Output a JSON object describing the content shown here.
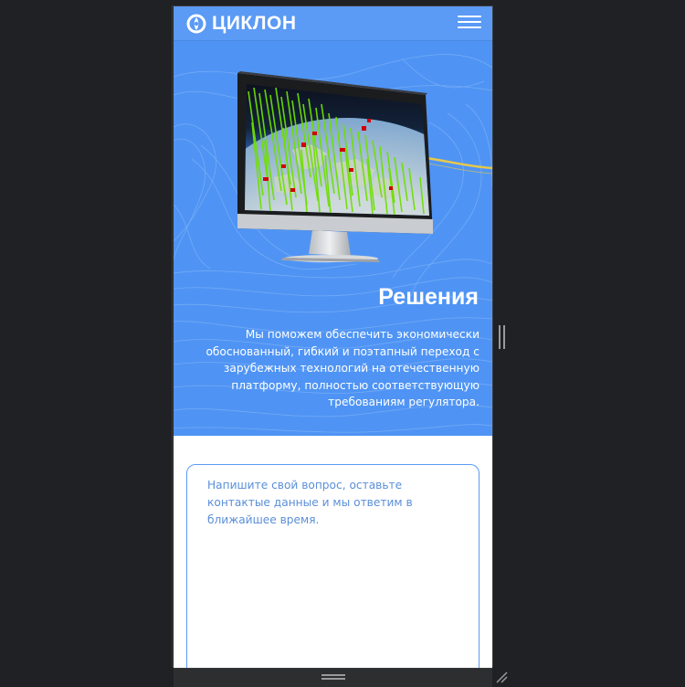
{
  "header": {
    "logo_text": "ЦИКЛОН",
    "logo_icon": "cyclone-logo-icon",
    "menu_icon": "hamburger-menu-icon"
  },
  "hero": {
    "title": "Решения",
    "text": "Мы поможем обеспечить экономически обоснованный, гибкий и поэтапный переход с зарубежных технологий на отечественную платформу, полностью соответствующую требованиям регулятора.",
    "image_icon": "monitor-globe-illustration"
  },
  "form": {
    "message_placeholder": "Напишите свой вопрос, оставьте контактые данные и мы ответим в ближайшее время.",
    "message_value": ""
  },
  "devtools": {
    "horizontal_handle_icon": "drag-handle-icon",
    "vertical_handle_icon": "drag-handle-icon",
    "resize_icon": "resize-corner-icon"
  },
  "colors": {
    "brand_blue": "#5b9af5",
    "hero_blue": "#4f94f4",
    "page_bg": "#202124",
    "placeholder": "#5b8fd8"
  }
}
